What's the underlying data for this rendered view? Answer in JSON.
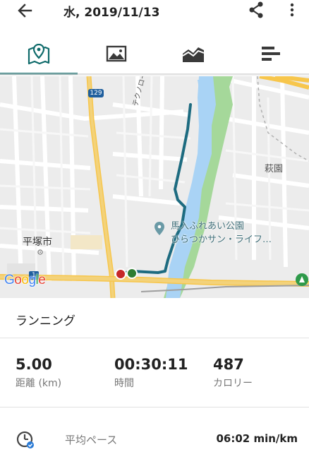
{
  "header": {
    "title": "水, 2019/11/13",
    "back_icon": "arrow-back-icon",
    "share_icon": "share-icon",
    "more_icon": "more-vert-icon"
  },
  "tabs": [
    {
      "icon": "map-icon",
      "active": true
    },
    {
      "icon": "photo-icon",
      "active": false
    },
    {
      "icon": "chart-icon",
      "active": false
    },
    {
      "icon": "list-icon",
      "active": false
    }
  ],
  "map": {
    "route_badge": "129",
    "road_label": "テクノロード",
    "district_label": "萩園",
    "city_label": "平塚市",
    "park_line1": "馬入ふれあい公園",
    "park_line2": "ひらつかサン・ライフ…",
    "route_badge_small": "1",
    "google_logo": "Google",
    "route_color": "#1d6b80",
    "start_marker_color": "#c62828",
    "end_marker_color": "#2e7d32"
  },
  "activity": {
    "type": "ランニング"
  },
  "stats": [
    {
      "value": "5.00",
      "label": "距離 (km)"
    },
    {
      "value": "00:30:11",
      "label": "時間"
    },
    {
      "value": "487",
      "label": "カロリー"
    }
  ],
  "pace": {
    "label": "平均ペース",
    "value": "06:02 min/km"
  }
}
